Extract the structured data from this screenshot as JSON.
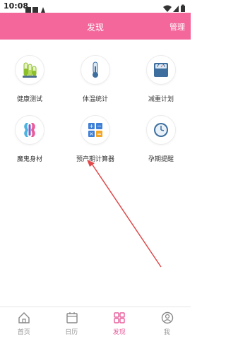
{
  "status_bar": {
    "time": "10:08"
  },
  "header": {
    "title": "发现",
    "action_label": "管理"
  },
  "grid": {
    "items": [
      {
        "label": "健康测试",
        "icon": "test-tubes-icon"
      },
      {
        "label": "体温统计",
        "icon": "thermometer-icon"
      },
      {
        "label": "减重计划",
        "icon": "weight-scale-icon"
      },
      {
        "label": "魔鬼身材",
        "icon": "body-shape-icon"
      },
      {
        "label": "预产期计算器",
        "icon": "calculator-icon"
      },
      {
        "label": "孕期提醒",
        "icon": "clock-icon"
      }
    ]
  },
  "tab_bar": {
    "tabs": [
      {
        "label": "首页",
        "icon": "home-icon",
        "active": false
      },
      {
        "label": "日历",
        "icon": "calendar-icon",
        "active": false
      },
      {
        "label": "发现",
        "icon": "discover-grid-icon",
        "active": true
      },
      {
        "label": "我",
        "icon": "user-icon",
        "active": false
      }
    ]
  },
  "colors": {
    "header_bg": "#f3679b",
    "active_tab": "#e85d9b",
    "annotation_arrow": "#e0484a"
  }
}
